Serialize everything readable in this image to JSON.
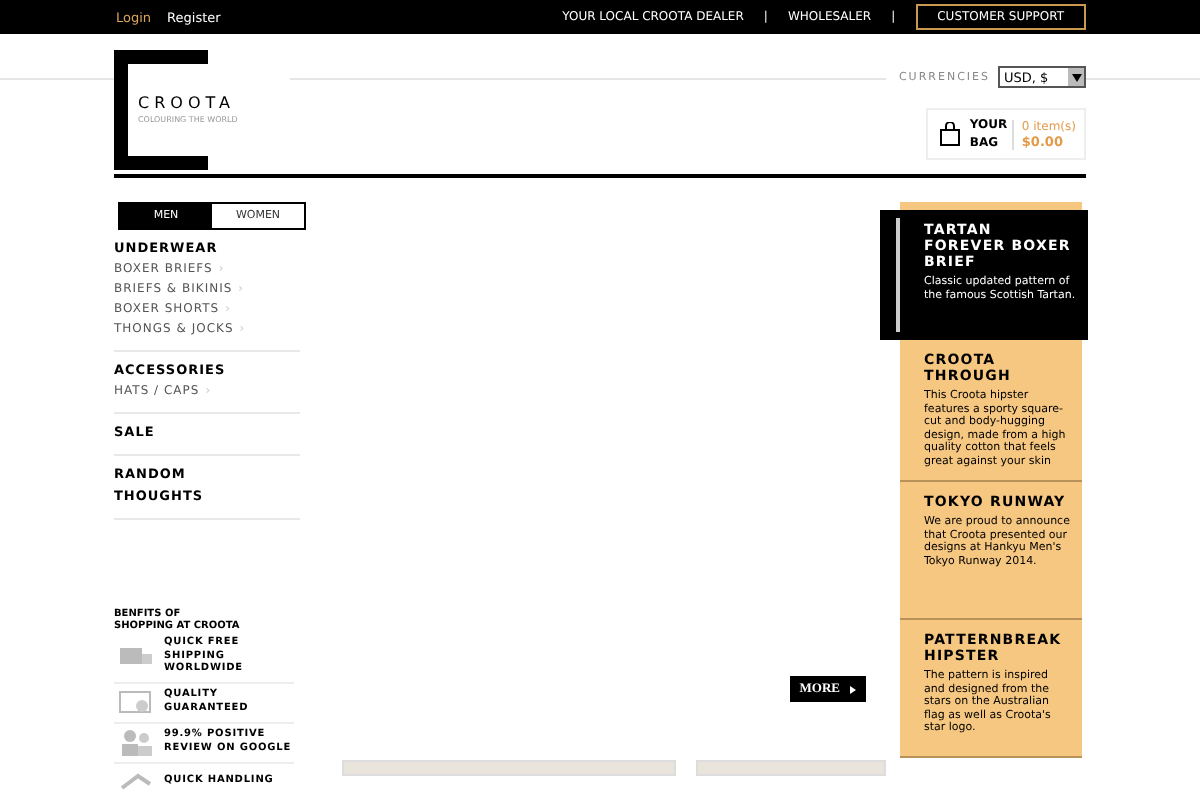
{
  "top_bar": {
    "login": "Login",
    "register": "Register",
    "links": [
      {
        "label": "YOUR LOCAL CROOTA DEALER",
        "separator": "|"
      },
      {
        "label": "WHOLESALER",
        "separator": "|"
      }
    ],
    "support": "CUSTOMER SUPPORT"
  },
  "header": {
    "logo": {
      "name": "CROOTA",
      "tagline": "COLOURING THE WORLD"
    },
    "currencies": {
      "label": "CURRENCIES",
      "value": "USD, $"
    },
    "bag": {
      "label": "YOUR BAG",
      "items": "0 item(s)",
      "total": "$0.00"
    }
  },
  "gender_tabs": [
    {
      "label": "MEN",
      "selected": true
    },
    {
      "label": "WOMEN",
      "selected": false
    }
  ],
  "menu": [
    {
      "title": "UNDERWEAR",
      "items": [
        {
          "label": "BOXER BRIEFS",
          "chevron": "›"
        },
        {
          "label": "BRIEFS & BIKINIS",
          "chevron": "›"
        },
        {
          "label": "BOXER SHORTS",
          "chevron": "›"
        },
        {
          "label": "THONGS & JOCKS",
          "chevron": "›"
        }
      ]
    },
    {
      "title": "ACCESSORIES",
      "items": [
        {
          "label": "HATS / CAPS",
          "chevron": "›"
        }
      ]
    },
    {
      "title": "SALE"
    },
    {
      "title": "RANDOM THOUGHTS"
    }
  ],
  "benefits": {
    "title": "BENFITS OF SHOPPING AT CROOTA",
    "items": [
      {
        "kind": "truck",
        "text": "QUICK FREE SHIPPING WORLDWIDE"
      },
      {
        "kind": "certificate",
        "text": "QUALITY GUARANTEED"
      },
      {
        "kind": "people",
        "text": "99.9% POSITIVE REVIEW ON GOOGLE"
      },
      {
        "kind": "arrow",
        "text": "QUICK HANDLING"
      }
    ]
  },
  "more_button": "MORE",
  "features": [
    {
      "title": "TARTAN FOREVER BOXER BRIEF",
      "text": "Classic updated pattern of the famous Scottish Tartan.",
      "highlighted": true
    },
    {
      "title": "CROOTA THROUGH",
      "text": "This Croota hipster features a sporty square-cut and body-hugging design, made from a high quality cotton that feels great against your skin",
      "highlighted": false
    },
    {
      "title": "TOKYO RUNWAY",
      "text": "We are proud to announce that Croota presented our designs at Hankyu Men's Tokyo Runway 2014.",
      "highlighted": false
    },
    {
      "title": "PATTERNBREAK HIPSTER",
      "text": "The pattern is inspired and designed from the stars on the Australian flag as well as Croota's star logo.",
      "highlighted": false
    }
  ]
}
